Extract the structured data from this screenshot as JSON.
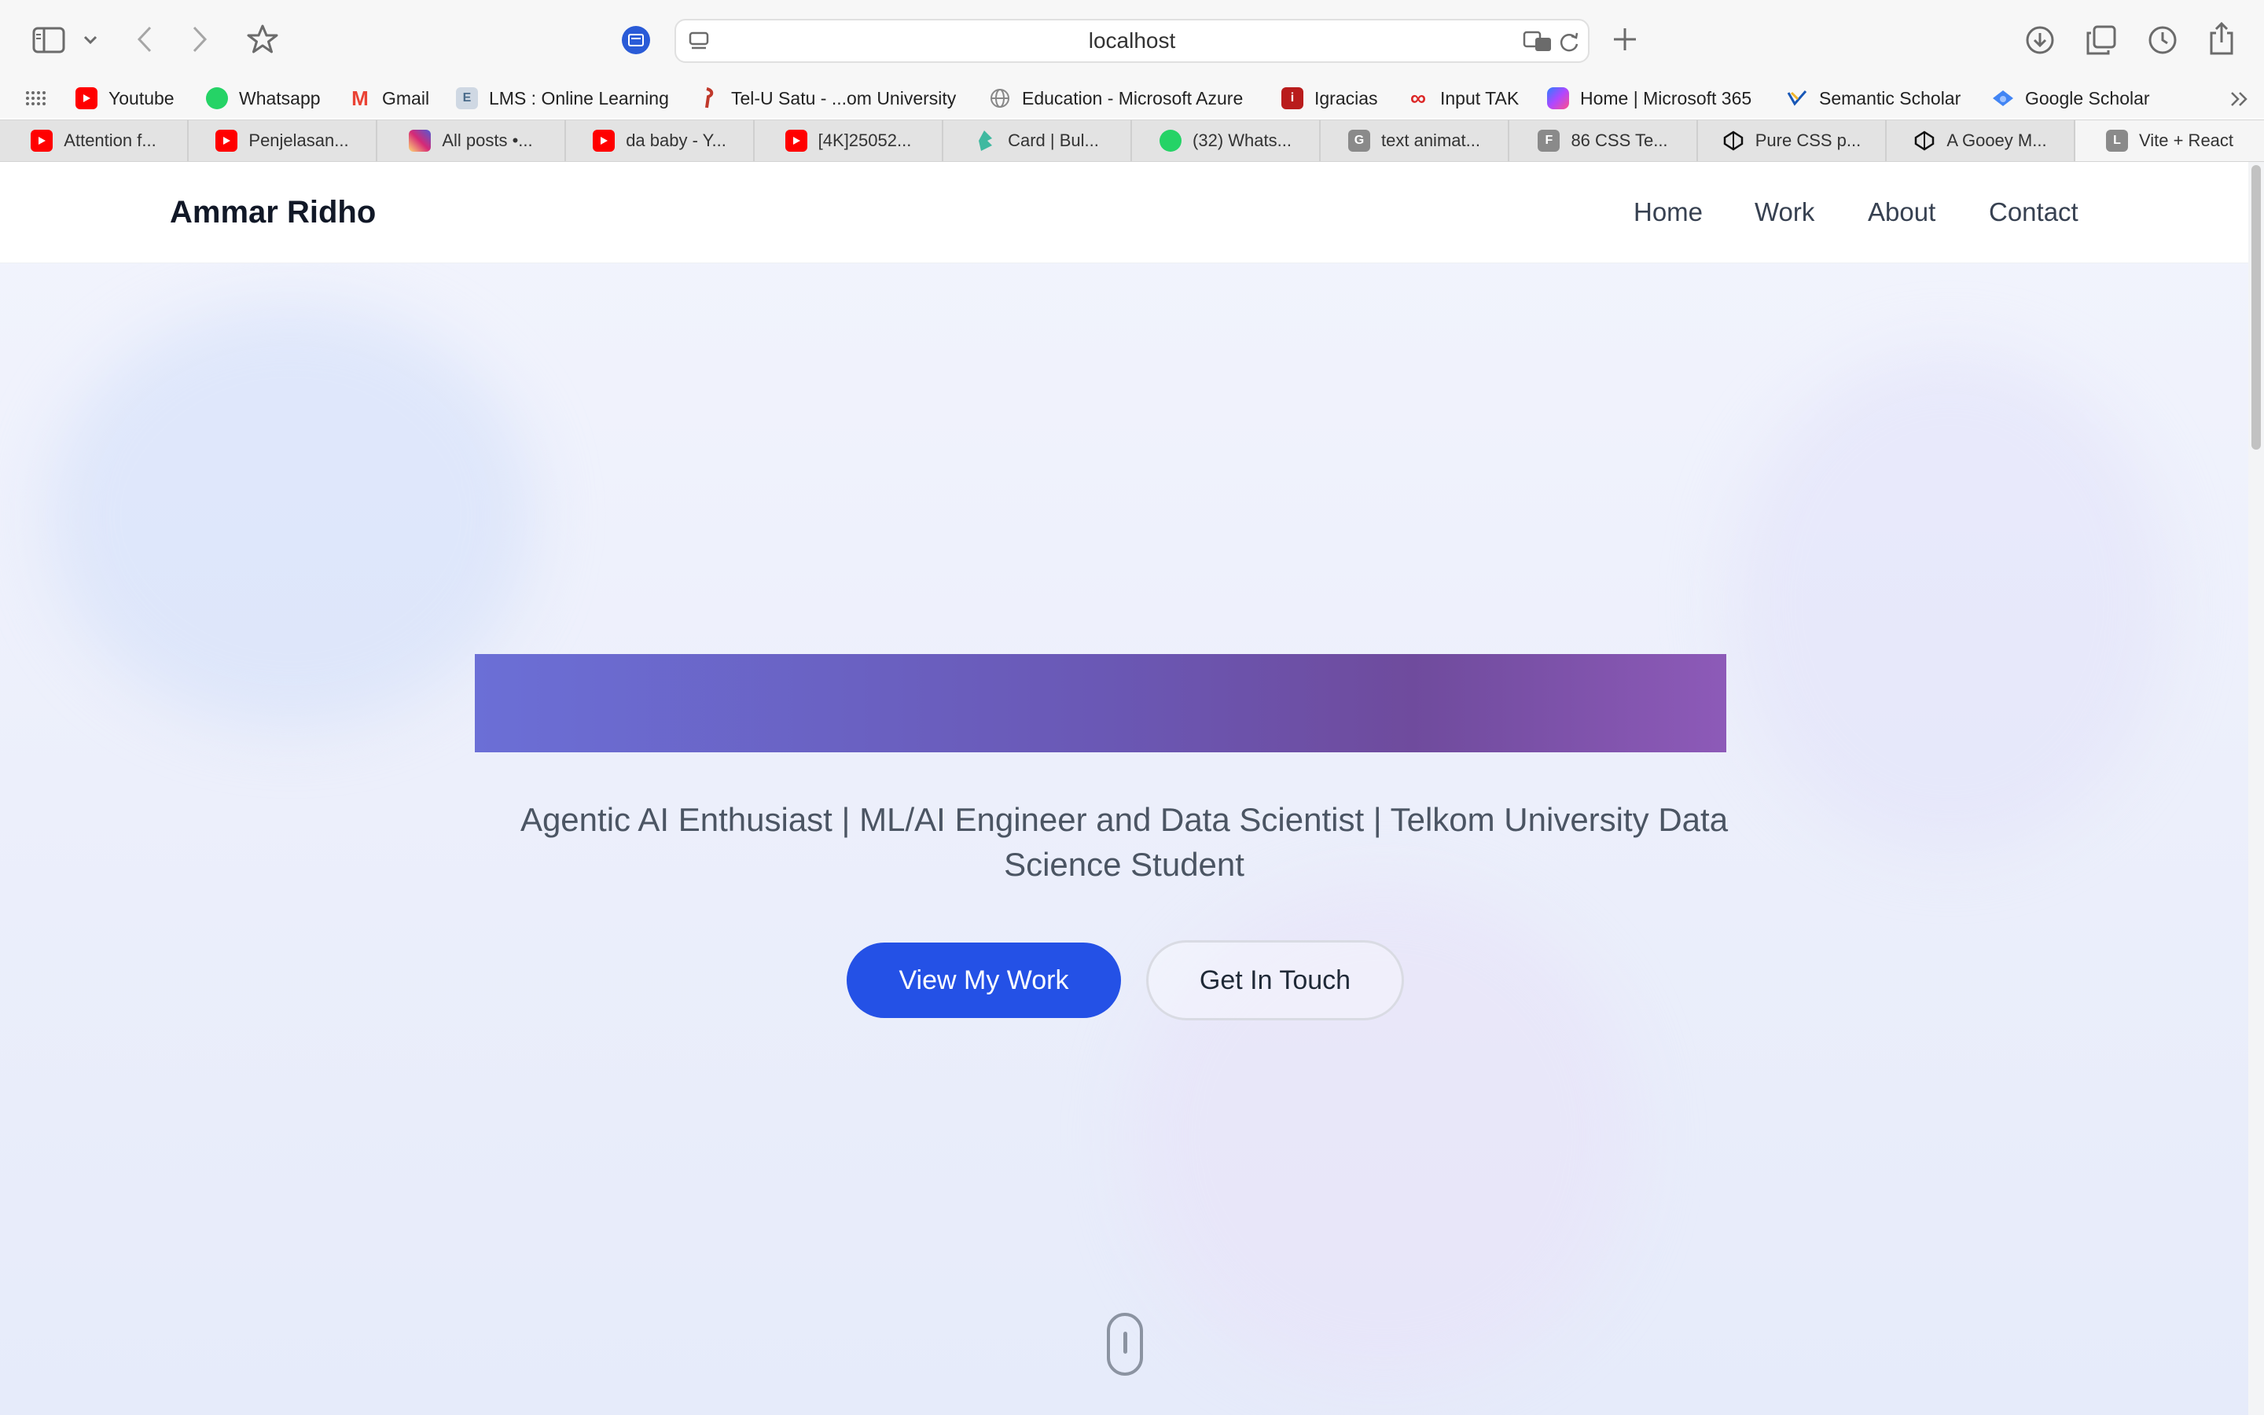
{
  "browser": {
    "url": "localhost",
    "icons": {
      "sidebar": "sidebar-icon",
      "back": "chevron-left-icon",
      "forward": "chevron-right-icon",
      "bookmark": "star-icon",
      "new_tab": "plus-icon",
      "downloads": "download-icon",
      "tabs_overview": "tabs-icon",
      "history": "clock-icon",
      "share": "share-icon"
    }
  },
  "bookmarks": [
    {
      "label": "Youtube",
      "icon": "youtube-icon",
      "color": "#ff0000"
    },
    {
      "label": "Whatsapp",
      "icon": "whatsapp-icon",
      "color": "#25d366"
    },
    {
      "label": "Gmail",
      "icon": "gmail-icon",
      "color": "#ea4335"
    },
    {
      "label": "LMS : Online Learning",
      "icon": "lms-icon",
      "color": "#6c8ebf"
    },
    {
      "label": "Tel-U Satu - ...om University",
      "icon": "telu-icon",
      "color": "#c0392b"
    },
    {
      "label": "Education - Microsoft Azure",
      "icon": "globe-icon",
      "color": "#888888"
    },
    {
      "label": "Igracias",
      "icon": "igracias-icon",
      "color": "#b91c1c"
    },
    {
      "label": "Input TAK",
      "icon": "infinity-icon",
      "color": "#dc2626"
    },
    {
      "label": "Home | Microsoft 365",
      "icon": "m365-icon",
      "color": "#7b61ff"
    },
    {
      "label": "Semantic Scholar",
      "icon": "semantic-scholar-icon",
      "color": "#1857b6"
    },
    {
      "label": "Google Scholar",
      "icon": "google-scholar-icon",
      "color": "#4285f4"
    }
  ],
  "tabs": [
    {
      "label": "Attention f...",
      "color": "#ff0000"
    },
    {
      "label": "Penjelasan...",
      "color": "#ff0000"
    },
    {
      "label": "All posts •...",
      "color": "#d62976"
    },
    {
      "label": "da baby - Y...",
      "color": "#ff0000"
    },
    {
      "label": "[4K]25052...",
      "color": "#ff0000"
    },
    {
      "label": "Card | Bul...",
      "color": "#3fb9a0"
    },
    {
      "label": "(32) Whats...",
      "color": "#25d366"
    },
    {
      "label": "text animat...",
      "color": "#8a8a8a",
      "letter": "G"
    },
    {
      "label": "86 CSS Te...",
      "color": "#8a8a8a",
      "letter": "F"
    },
    {
      "label": "Pure CSS p...",
      "color": "#111111"
    },
    {
      "label": "A Gooey M...",
      "color": "#111111"
    },
    {
      "label": "Vite + React",
      "color": "#8a8a8a",
      "letter": "L"
    }
  ],
  "site": {
    "brand": "Ammar Ridho",
    "nav": {
      "home": "Home",
      "work": "Work",
      "about": "About",
      "contact": "Contact"
    },
    "hero": {
      "tagline": "Agentic AI Enthusiast | ML/AI Engineer and Data Scientist | Telkom University Data Science Student",
      "primary_button": "View My Work",
      "secondary_button": "Get In Touch"
    },
    "accent_color": "#2451e6"
  }
}
